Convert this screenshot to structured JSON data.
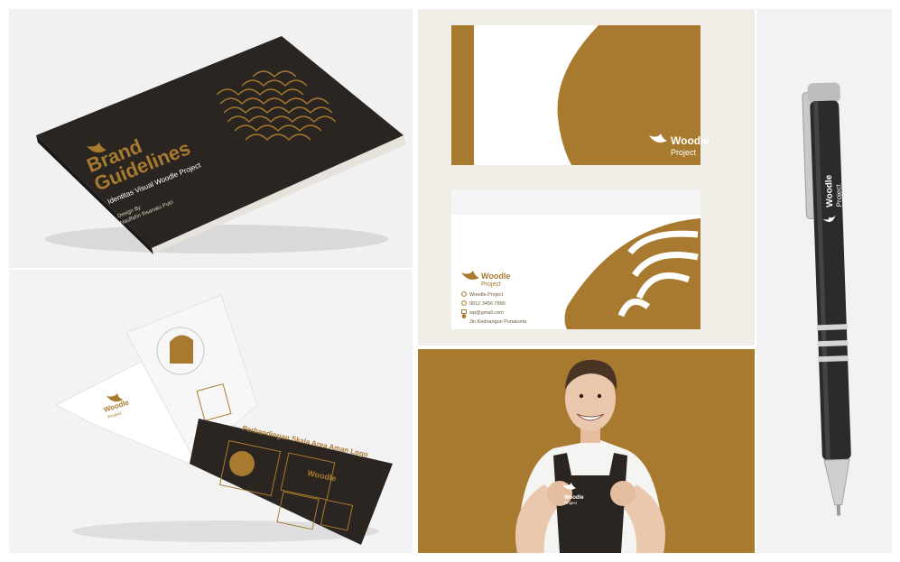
{
  "colors": {
    "brand_gold": "#a87a2f",
    "brand_dark": "#2b2521",
    "paper": "#ffffff",
    "background": "#f1f1f1"
  },
  "book": {
    "title_line1": "Brand",
    "title_line2": "Guidelines",
    "subtitle": "Identitas Visual Woodle Project",
    "credit_line1": "Design By",
    "credit_line2": "Nauffahn Ihsanatu Putri",
    "logo_icon": "woodle-logo-icon"
  },
  "open_book": {
    "page_heading": "Perbandingan Skala Area Aman Logo",
    "logo_word": "Woodle",
    "logo_sub": "Project"
  },
  "card": {
    "brand_name": "Woodle",
    "brand_sub": "Project"
  },
  "envelope": {
    "brand_name": "Woodle",
    "brand_sub": "Project",
    "contacts": [
      {
        "icon": "instagram-icon",
        "text": "Woodle.Project"
      },
      {
        "icon": "whatsapp-icon",
        "text": "0812 3456 7890"
      },
      {
        "icon": "mail-icon",
        "text": "wp@gmail.com"
      },
      {
        "icon": "location-icon",
        "text": "Jln.Kedirangun Punakorta"
      }
    ]
  },
  "apron": {
    "brand_name": "Woodle",
    "brand_sub": "Project"
  },
  "pen": {
    "brand_name": "Woodle",
    "brand_sub": "Project"
  }
}
